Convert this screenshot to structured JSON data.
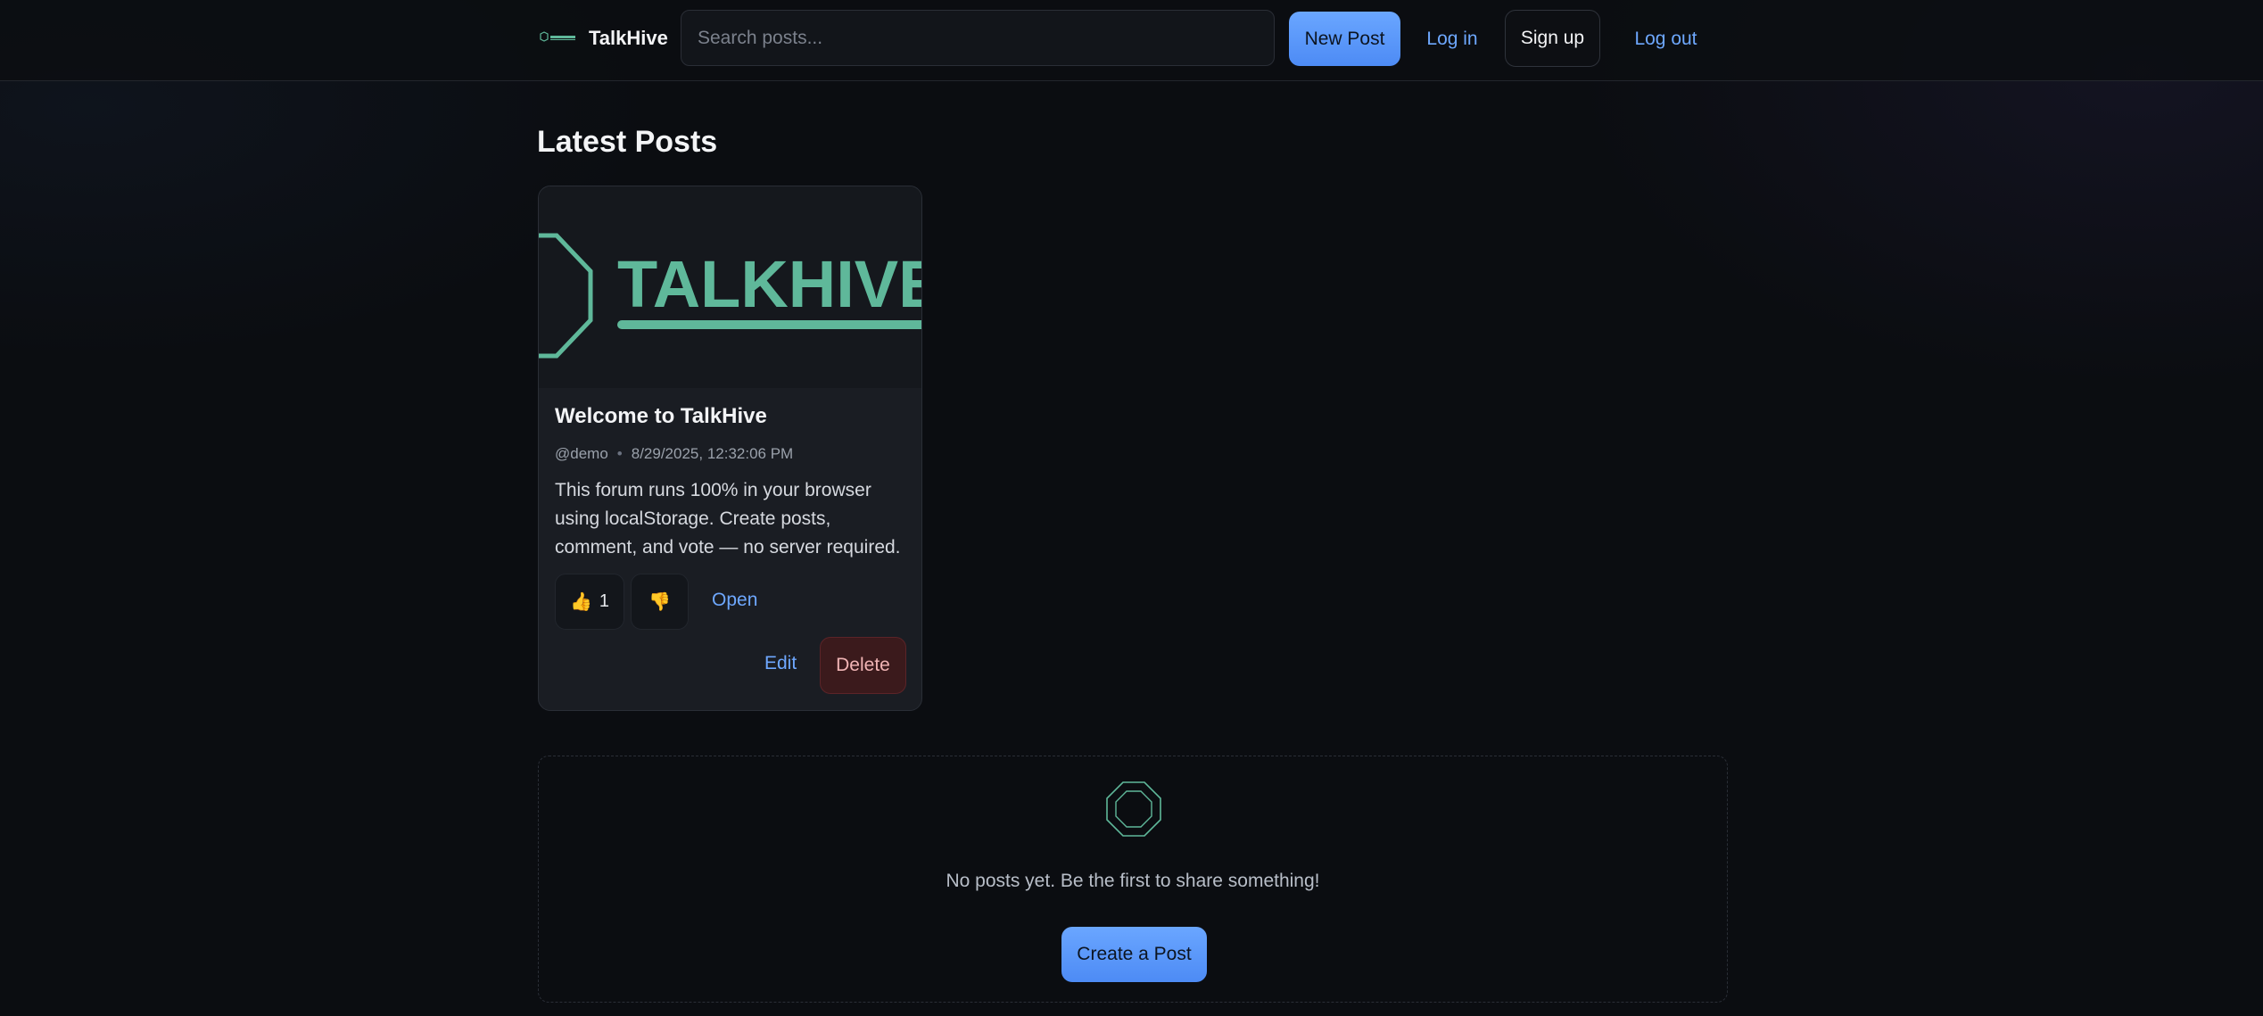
{
  "header": {
    "brand_name": "TalkHive",
    "logo_icon": "hexagon-logo-icon",
    "search_placeholder": "Search posts...",
    "new_post_label": "New Post",
    "login_label": "Log in",
    "signup_label": "Sign up",
    "logout_label": "Log out"
  },
  "main": {
    "section_title": "Latest Posts",
    "posts": [
      {
        "image_text": "TALKHIVE",
        "title": "Welcome to TalkHive",
        "author": "@demo",
        "timestamp": "8/29/2025, 12:32:06 PM",
        "body": "This forum runs 100% in your browser using localStorage. Create posts, comment, and vote — no server required.",
        "upvote_icon": "👍",
        "upvote_count": "1",
        "downvote_icon": "👎",
        "open_label": "Open",
        "edit_label": "Edit",
        "delete_label": "Delete"
      }
    ],
    "empty_state": {
      "icon": "octagon-icon",
      "message": "No posts yet. Be the first to share something!",
      "create_label": "Create a Post"
    }
  },
  "colors": {
    "background": "#0b0d11",
    "accent": "#5b9bff",
    "link": "#6ea8ff",
    "brand_green": "#5fb89a",
    "danger_bg": "#3b1a1c"
  }
}
